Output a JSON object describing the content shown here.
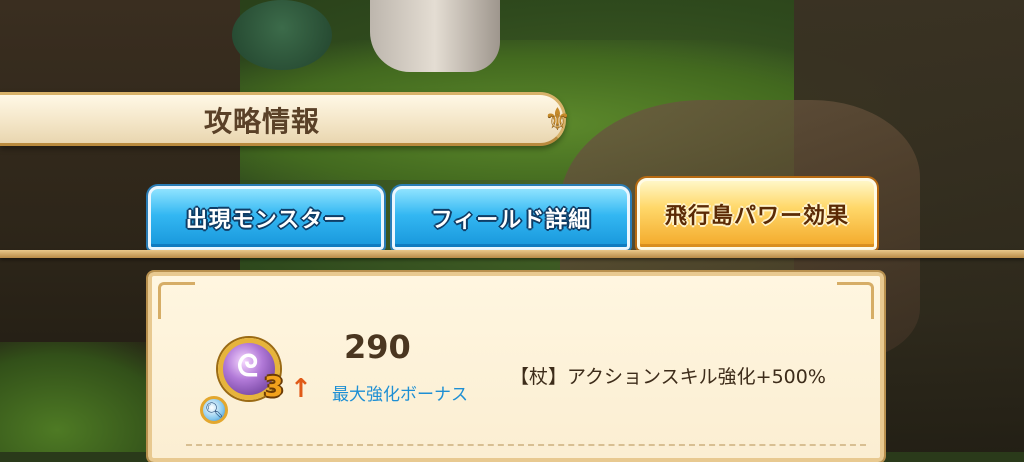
{
  "header": {
    "title": "攻略情報",
    "ornament_icon": "fleur-ornament-icon"
  },
  "tabs": [
    {
      "label": "出現モンスター",
      "active": false,
      "color": "#33b7f2"
    },
    {
      "label": "フィールド詳細",
      "active": false,
      "color": "#33b7f2"
    },
    {
      "label": "飛行島パワー効果",
      "active": true,
      "color": "#ffd86a"
    }
  ],
  "power_effect": {
    "emblem_icon": "staff-emblem-icon",
    "emblem_level": "3",
    "magnify_icon": "magnify-icon",
    "value": "290",
    "bonus_label": "最大強化ボーナス",
    "effect_text": "【杖】アクションスキル強化+500%"
  }
}
